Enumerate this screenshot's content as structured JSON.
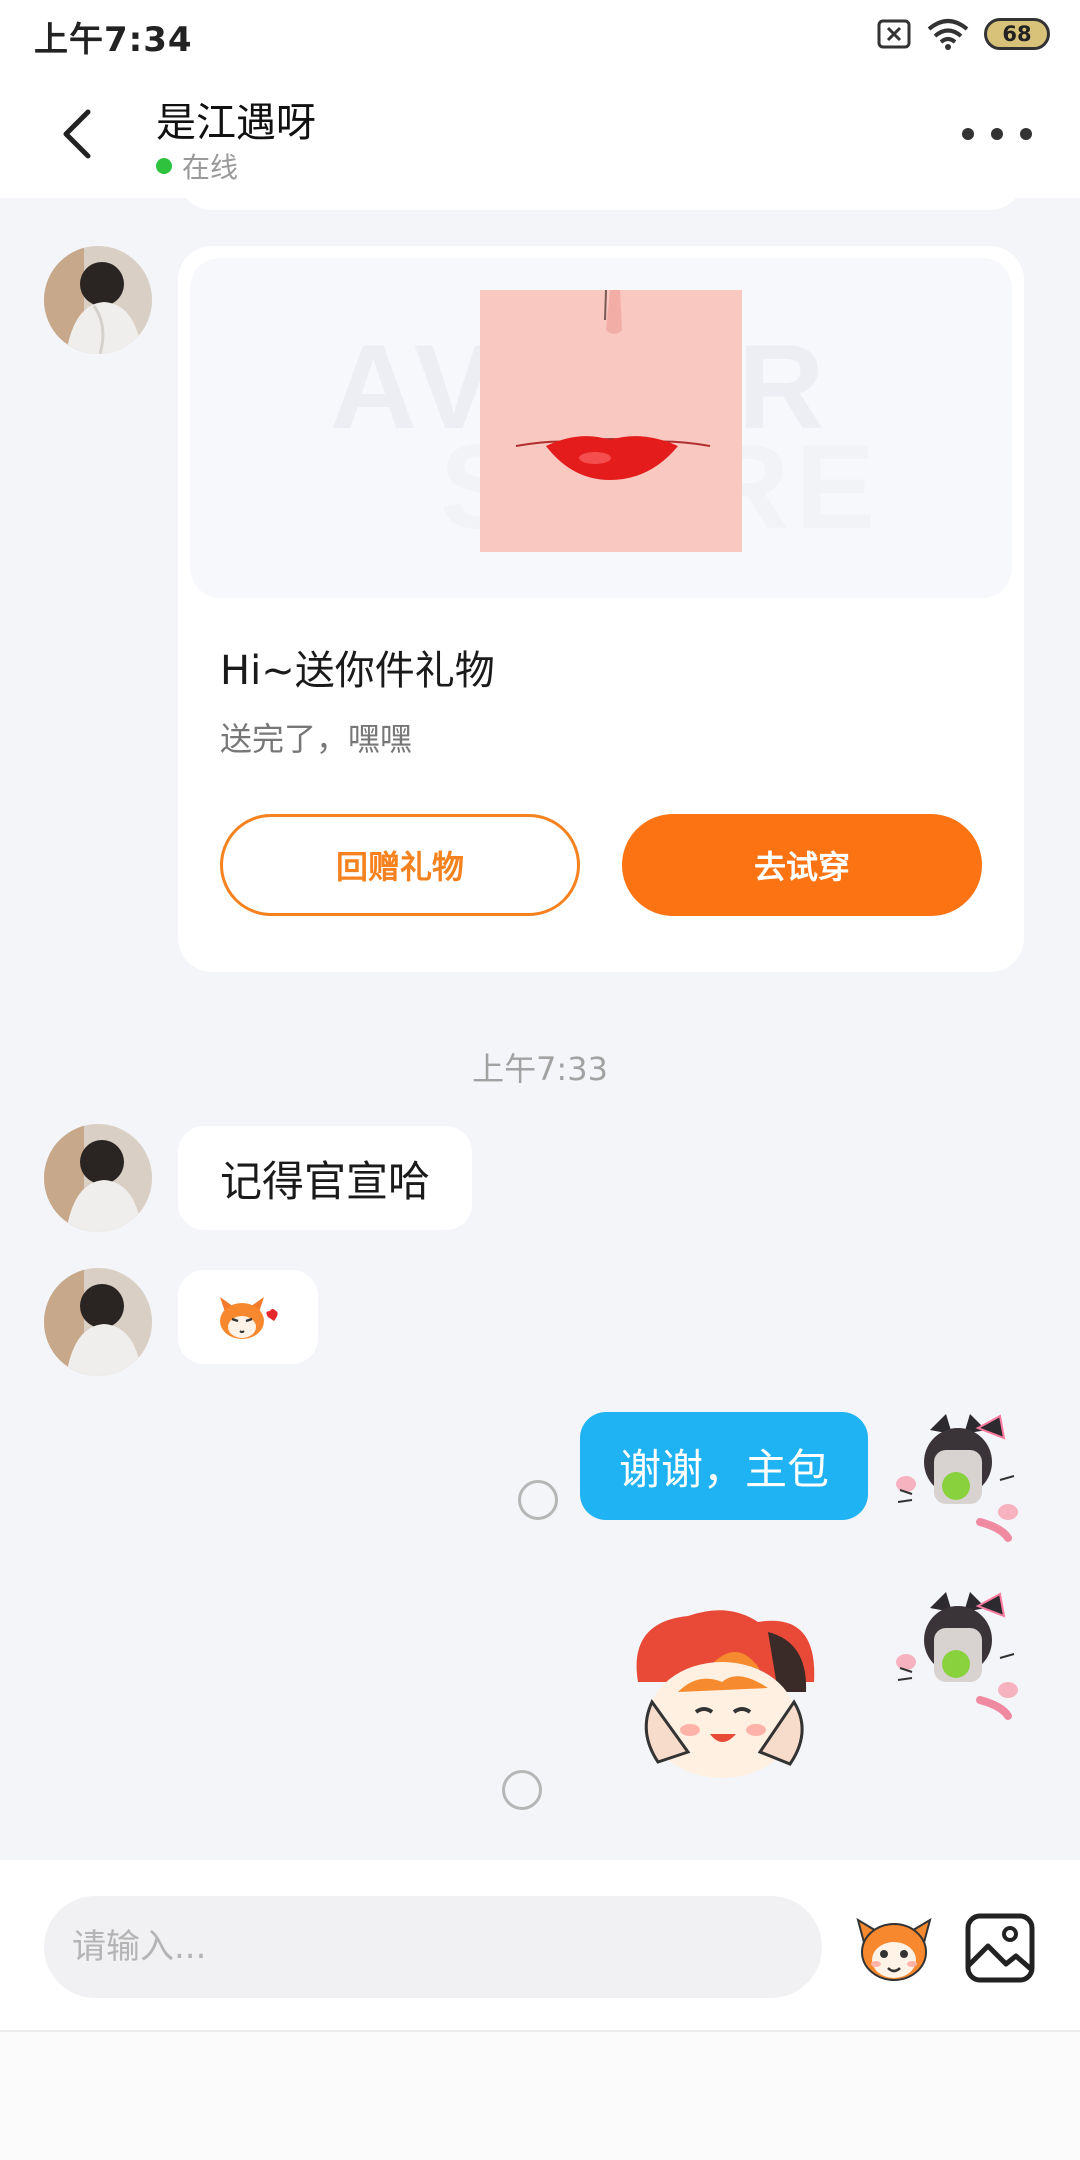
{
  "status_bar": {
    "time": "上午7:34",
    "battery": "68"
  },
  "header": {
    "title": "是江遇呀",
    "status": "在线"
  },
  "gift_card": {
    "watermark_line1": "AVATAR",
    "watermark_line2": "STORE",
    "title": "Hi~送你件礼物",
    "subtitle": "送完了，嘿嘿",
    "return_gift_label": "回赠礼物",
    "try_on_label": "去试穿",
    "accent_color": "#fb7313"
  },
  "timestamp": "上午7:33",
  "messages": [
    {
      "side": "left",
      "type": "text",
      "text": "记得官宣哈"
    },
    {
      "side": "left",
      "type": "emoji",
      "icon": "fox-emoji-icon"
    },
    {
      "side": "right",
      "type": "text",
      "text": "谢谢，主包"
    },
    {
      "side": "right",
      "type": "sticker",
      "icon": "fox-hug-sticker-icon"
    }
  ],
  "input": {
    "placeholder": "请输入..."
  },
  "colors": {
    "my_bubble": "#1fb3f3",
    "online_dot": "#2fc23f"
  }
}
